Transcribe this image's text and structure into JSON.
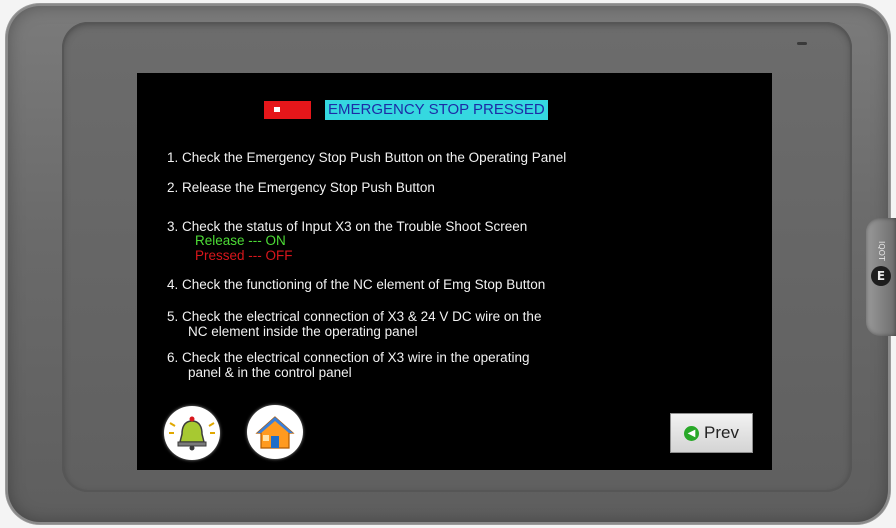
{
  "panel": {
    "brand_logo": "E",
    "brand_text": "IQOT"
  },
  "screen": {
    "title": "EMERGENCY STOP PRESSED",
    "instructions": [
      {
        "text": "1. Check the Emergency Stop Push Button on the Operating Panel"
      },
      {
        "text": "2. Release the Emergency Stop Push Button"
      },
      {
        "text": "3. Check the status of Input X3 on the Trouble Shoot Screen",
        "status_on": "Release --- ON",
        "status_off": "Pressed --- OFF"
      },
      {
        "text": "4. Check the functioning of the NC element of Emg Stop Button"
      },
      {
        "line1": "5. Check the electrical connection of X3 & 24 V DC wire on the",
        "line2": "NC element inside the operating panel"
      },
      {
        "line1": "6. Check the electrical connection of X3 wire in the operating",
        "line2": "panel & in the control panel"
      }
    ],
    "buttons": {
      "alarm_icon": "alarm-bell-icon",
      "home_icon": "home-icon",
      "prev_label": "Prev",
      "prev_icon": "green-back-arrow-icon"
    },
    "colors": {
      "title_bg": "#35d8e0",
      "title_text": "#1d2ca6",
      "alarm_lamp": "#e5161a",
      "status_on": "#4ddc36",
      "status_off": "#d8161c"
    }
  }
}
